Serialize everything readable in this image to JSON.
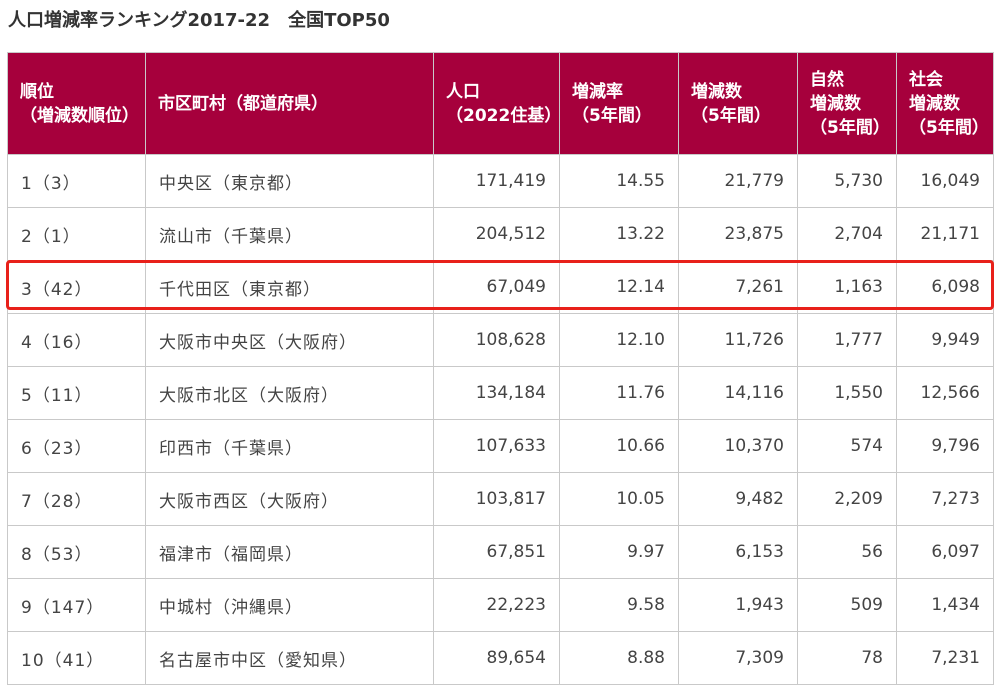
{
  "title": "人口増減率ランキング2017-22　全国TOP50",
  "colors": {
    "header_bg": "#a6003c",
    "header_text": "#ffffff",
    "highlight": "#e8201a",
    "border": "#c9c9c9"
  },
  "chart_data": {
    "type": "table",
    "title": "人口増減率ランキング2017-22　全国TOP50",
    "columns": [
      "順位\n（増減数順位）",
      "市区町村（都道府県）",
      "人口\n（2022住基）",
      "増減率\n（5年間）",
      "増減数\n（5年間）",
      "自然\n増減数\n（5年間）",
      "社会\n増減数\n（5年間）"
    ],
    "highlighted_row_index": 2,
    "rows": [
      [
        "1（3）",
        "中央区（東京都）",
        "171,419",
        "14.55",
        "21,779",
        "5,730",
        "16,049"
      ],
      [
        "2（1）",
        "流山市（千葉県）",
        "204,512",
        "13.22",
        "23,875",
        "2,704",
        "21,171"
      ],
      [
        "3（42）",
        "千代田区（東京都）",
        "67,049",
        "12.14",
        "7,261",
        "1,163",
        "6,098"
      ],
      [
        "4（16）",
        "大阪市中央区（大阪府）",
        "108,628",
        "12.10",
        "11,726",
        "1,777",
        "9,949"
      ],
      [
        "5（11）",
        "大阪市北区（大阪府）",
        "134,184",
        "11.76",
        "14,116",
        "1,550",
        "12,566"
      ],
      [
        "6（23）",
        "印西市（千葉県）",
        "107,633",
        "10.66",
        "10,370",
        "574",
        "9,796"
      ],
      [
        "7（28）",
        "大阪市西区（大阪府）",
        "103,817",
        "10.05",
        "9,482",
        "2,209",
        "7,273"
      ],
      [
        "8（53）",
        "福津市（福岡県）",
        "67,851",
        "9.97",
        "6,153",
        "56",
        "6,097"
      ],
      [
        "9（147）",
        "中城村（沖縄県）",
        "22,223",
        "9.58",
        "1,943",
        "509",
        "1,434"
      ],
      [
        "10（41）",
        "名古屋市中区（愛知県）",
        "89,654",
        "8.88",
        "7,309",
        "78",
        "7,231"
      ]
    ]
  }
}
